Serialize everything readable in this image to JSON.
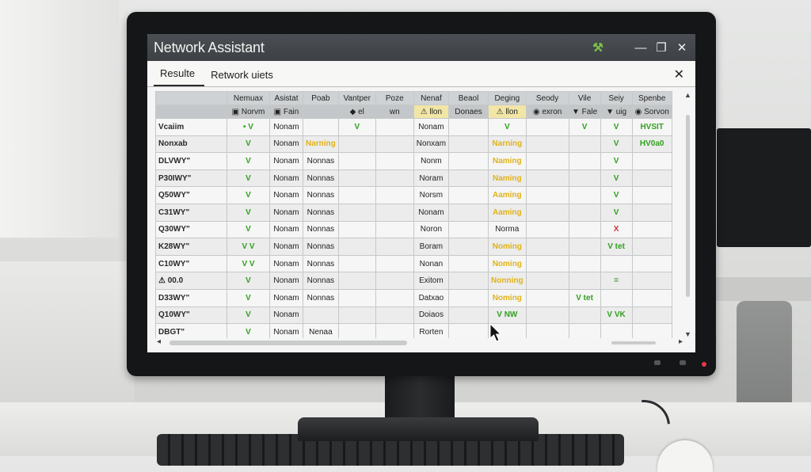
{
  "window": {
    "title": "Network Assistant",
    "icons": [
      "wrench-icon",
      "minimize-icon",
      "maximize-icon",
      "close-icon"
    ]
  },
  "tabs": [
    {
      "label": "Resulte",
      "active": true
    },
    {
      "label": "Retwork uiets",
      "active": false
    }
  ],
  "grid": {
    "headers": [
      "",
      "Nemuax",
      "Asistat",
      "Poab",
      "Vantper",
      "Poze",
      "Nenaf",
      "Beaol",
      "Deging",
      "Seody",
      "Vile",
      "Seiy",
      "Spenbe"
    ],
    "subheaders": [
      "",
      "▣ Norvm",
      "▣ Fain",
      "",
      "◆ el",
      "wn",
      "⚠ llon",
      "Donaes",
      "⚠ llon",
      "◉ exron",
      "▼ Fale",
      "▼ uig",
      "◉ Sorvon"
    ],
    "rows": [
      [
        "Vcaiim",
        "• V",
        "Nonam",
        "",
        "V",
        "",
        "Nonam",
        "",
        "V",
        "",
        "V",
        "V",
        "HVSIT"
      ],
      [
        "Nonxab",
        "V",
        "Nonam",
        "Narning",
        "",
        "",
        "Nonxam",
        "",
        "Narning",
        "",
        "",
        "V",
        "HV0a0"
      ],
      [
        "DLVWY\"",
        "V",
        "Nonam",
        "Nonnas",
        "",
        "",
        "Nonm",
        "",
        "Naming",
        "",
        "",
        "V",
        ""
      ],
      [
        "P30IWY\"",
        "V",
        "Nonam",
        "Nonnas",
        "",
        "",
        "Noram",
        "",
        "Naming",
        "",
        "",
        "V",
        ""
      ],
      [
        "Q50WY\"",
        "V",
        "Nonam",
        "Nonnas",
        "",
        "",
        "Norsm",
        "",
        "Aaming",
        "",
        "",
        "V",
        ""
      ],
      [
        "C31WY\"",
        "V",
        "Nonam",
        "Nonnas",
        "",
        "",
        "Nonam",
        "",
        "Aaming",
        "",
        "",
        "V",
        ""
      ],
      [
        "Q30WY\"",
        "V",
        "Nonam",
        "Nonnas",
        "",
        "",
        "Noron",
        "",
        "Norma",
        "",
        "",
        "X",
        ""
      ],
      [
        "K28WY\"",
        "V V",
        "Nonam",
        "Nonnas",
        "",
        "",
        "Boram",
        "",
        "Noming",
        "",
        "",
        "V tet",
        ""
      ],
      [
        "C10WY\"",
        "V V",
        "Nonam",
        "Nonnas",
        "",
        "",
        "Nonan",
        "",
        "Noming",
        "",
        "",
        "",
        ""
      ],
      [
        "⚠ 00.0",
        "V",
        "Nonam",
        "Nonnas",
        "",
        "",
        "Exitom",
        "",
        "Nonning",
        "",
        "",
        "=",
        ""
      ],
      [
        "D33WY\"",
        "V",
        "Nonam",
        "Nonnas",
        "",
        "",
        "Datxao",
        "",
        "Noming",
        "",
        "V tet",
        "",
        ""
      ],
      [
        "Q10WY\"",
        "V",
        "Nonam",
        "",
        "",
        "",
        "Doiaos",
        "",
        "V NW",
        "",
        "",
        "V VK",
        ""
      ],
      [
        "DBGT\"",
        "V",
        "Nonam",
        "Nenaa",
        "",
        "",
        "Rorten",
        "",
        "",
        "",
        "",
        "",
        ""
      ]
    ]
  }
}
